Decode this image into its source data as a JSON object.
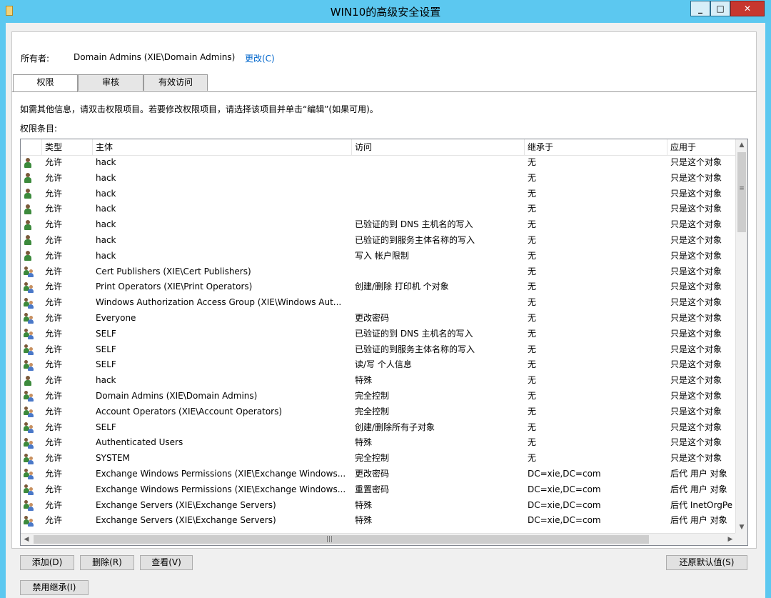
{
  "window": {
    "title": "WIN10的高级安全设置"
  },
  "owner": {
    "label": "所有者:",
    "value": "Domain Admins (XIE\\Domain Admins)",
    "change_link": "更改(C)"
  },
  "tabs": [
    {
      "label": "权限",
      "active": true
    },
    {
      "label": "审核",
      "active": false
    },
    {
      "label": "有效访问",
      "active": false
    }
  ],
  "info_text": "如需其他信息，请双击权限项目。若要修改权限项目，请选择该项目并单击“编辑”(如果可用)。",
  "entries_label": "权限条目:",
  "columns": {
    "type": "类型",
    "principal": "主体",
    "access": "访问",
    "inherited": "继承于",
    "applies": "应用于"
  },
  "rows": [
    {
      "icon": "user",
      "type": "允许",
      "principal": "hack",
      "access": "",
      "inherited": "无",
      "applies": "只是这个对象"
    },
    {
      "icon": "user",
      "type": "允许",
      "principal": "hack",
      "access": "",
      "inherited": "无",
      "applies": "只是这个对象"
    },
    {
      "icon": "user",
      "type": "允许",
      "principal": "hack",
      "access": "",
      "inherited": "无",
      "applies": "只是这个对象"
    },
    {
      "icon": "user",
      "type": "允许",
      "principal": "hack",
      "access": "",
      "inherited": "无",
      "applies": "只是这个对象"
    },
    {
      "icon": "user",
      "type": "允许",
      "principal": "hack",
      "access": "已验证的到 DNS 主机名的写入",
      "inherited": "无",
      "applies": "只是这个对象"
    },
    {
      "icon": "user",
      "type": "允许",
      "principal": "hack",
      "access": "已验证的到服务主体名称的写入",
      "inherited": "无",
      "applies": "只是这个对象"
    },
    {
      "icon": "user",
      "type": "允许",
      "principal": "hack",
      "access": "写入 帐户限制",
      "inherited": "无",
      "applies": "只是这个对象"
    },
    {
      "icon": "group",
      "type": "允许",
      "principal": "Cert Publishers (XIE\\Cert Publishers)",
      "access": "",
      "inherited": "无",
      "applies": "只是这个对象"
    },
    {
      "icon": "group",
      "type": "允许",
      "principal": "Print Operators (XIE\\Print Operators)",
      "access": "创建/删除 打印机 个对象",
      "inherited": "无",
      "applies": "只是这个对象"
    },
    {
      "icon": "group",
      "type": "允许",
      "principal": "Windows Authorization Access Group (XIE\\Windows Aut...",
      "access": "",
      "inherited": "无",
      "applies": "只是这个对象"
    },
    {
      "icon": "group",
      "type": "允许",
      "principal": "Everyone",
      "access": "更改密码",
      "inherited": "无",
      "applies": "只是这个对象"
    },
    {
      "icon": "group",
      "type": "允许",
      "principal": "SELF",
      "access": "已验证的到 DNS 主机名的写入",
      "inherited": "无",
      "applies": "只是这个对象"
    },
    {
      "icon": "group",
      "type": "允许",
      "principal": "SELF",
      "access": "已验证的到服务主体名称的写入",
      "inherited": "无",
      "applies": "只是这个对象"
    },
    {
      "icon": "group",
      "type": "允许",
      "principal": "SELF",
      "access": "读/写 个人信息",
      "inherited": "无",
      "applies": "只是这个对象"
    },
    {
      "icon": "user",
      "type": "允许",
      "principal": "hack",
      "access": "特殊",
      "inherited": "无",
      "applies": "只是这个对象"
    },
    {
      "icon": "group",
      "type": "允许",
      "principal": "Domain Admins (XIE\\Domain Admins)",
      "access": "完全控制",
      "inherited": "无",
      "applies": "只是这个对象"
    },
    {
      "icon": "group",
      "type": "允许",
      "principal": "Account Operators (XIE\\Account Operators)",
      "access": "完全控制",
      "inherited": "无",
      "applies": "只是这个对象"
    },
    {
      "icon": "group",
      "type": "允许",
      "principal": "SELF",
      "access": "创建/删除所有子对象",
      "inherited": "无",
      "applies": "只是这个对象"
    },
    {
      "icon": "group",
      "type": "允许",
      "principal": "Authenticated Users",
      "access": "特殊",
      "inherited": "无",
      "applies": "只是这个对象"
    },
    {
      "icon": "group",
      "type": "允许",
      "principal": "SYSTEM",
      "access": "完全控制",
      "inherited": "无",
      "applies": "只是这个对象"
    },
    {
      "icon": "group",
      "type": "允许",
      "principal": "Exchange Windows Permissions (XIE\\Exchange Windows...",
      "access": "更改密码",
      "inherited": "DC=xie,DC=com",
      "applies": "后代 用户 对象"
    },
    {
      "icon": "group",
      "type": "允许",
      "principal": "Exchange Windows Permissions (XIE\\Exchange Windows...",
      "access": "重置密码",
      "inherited": "DC=xie,DC=com",
      "applies": "后代 用户 对象"
    },
    {
      "icon": "group",
      "type": "允许",
      "principal": "Exchange Servers (XIE\\Exchange Servers)",
      "access": "特殊",
      "inherited": "DC=xie,DC=com",
      "applies": "后代 InetOrgPe"
    },
    {
      "icon": "group",
      "type": "允许",
      "principal": "Exchange Servers (XIE\\Exchange Servers)",
      "access": "特殊",
      "inherited": "DC=xie,DC=com",
      "applies": "后代 用户 对象"
    }
  ],
  "buttons": {
    "add": "添加(D)",
    "remove": "删除(R)",
    "view": "查看(V)",
    "restore_defaults": "还原默认值(S)",
    "disable_inheritance": "禁用继承(I)"
  }
}
